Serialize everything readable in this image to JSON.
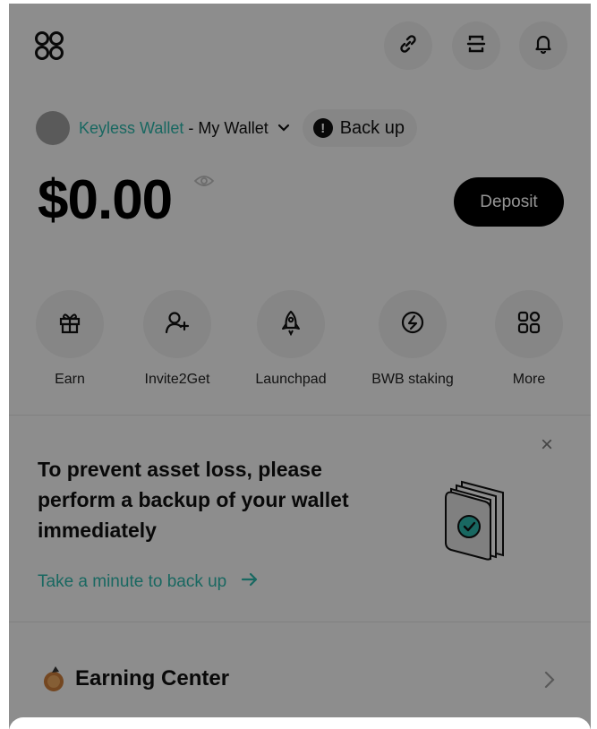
{
  "header": {
    "icons": [
      "apps-grid-icon",
      "link-icon",
      "scan-icon",
      "bell-icon"
    ]
  },
  "wallet": {
    "name_accent": "Keyless Wallet",
    "separator": "-",
    "name": "My Wallet",
    "backup_label": "Back up"
  },
  "balance": {
    "amount": "$0.00",
    "deposit_label": "Deposit"
  },
  "actions": [
    {
      "label": "Earn",
      "icon": "gift-icon"
    },
    {
      "label": "Invite2Get",
      "icon": "add-user-icon"
    },
    {
      "label": "Launchpad",
      "icon": "rocket-icon"
    },
    {
      "label": "BWB staking",
      "icon": "staking-icon"
    },
    {
      "label": "More",
      "icon": "more-grid-icon"
    }
  ],
  "banner": {
    "title": "To prevent asset loss, please perform a backup of your wallet immediately",
    "link": "Take a minute to back up",
    "close": "×"
  },
  "earning": {
    "title": "Earning Center"
  },
  "colors": {
    "accent": "#2bb3a7",
    "overlay": "rgba(0,0,0,0.42)",
    "button_dark": "#000000"
  }
}
